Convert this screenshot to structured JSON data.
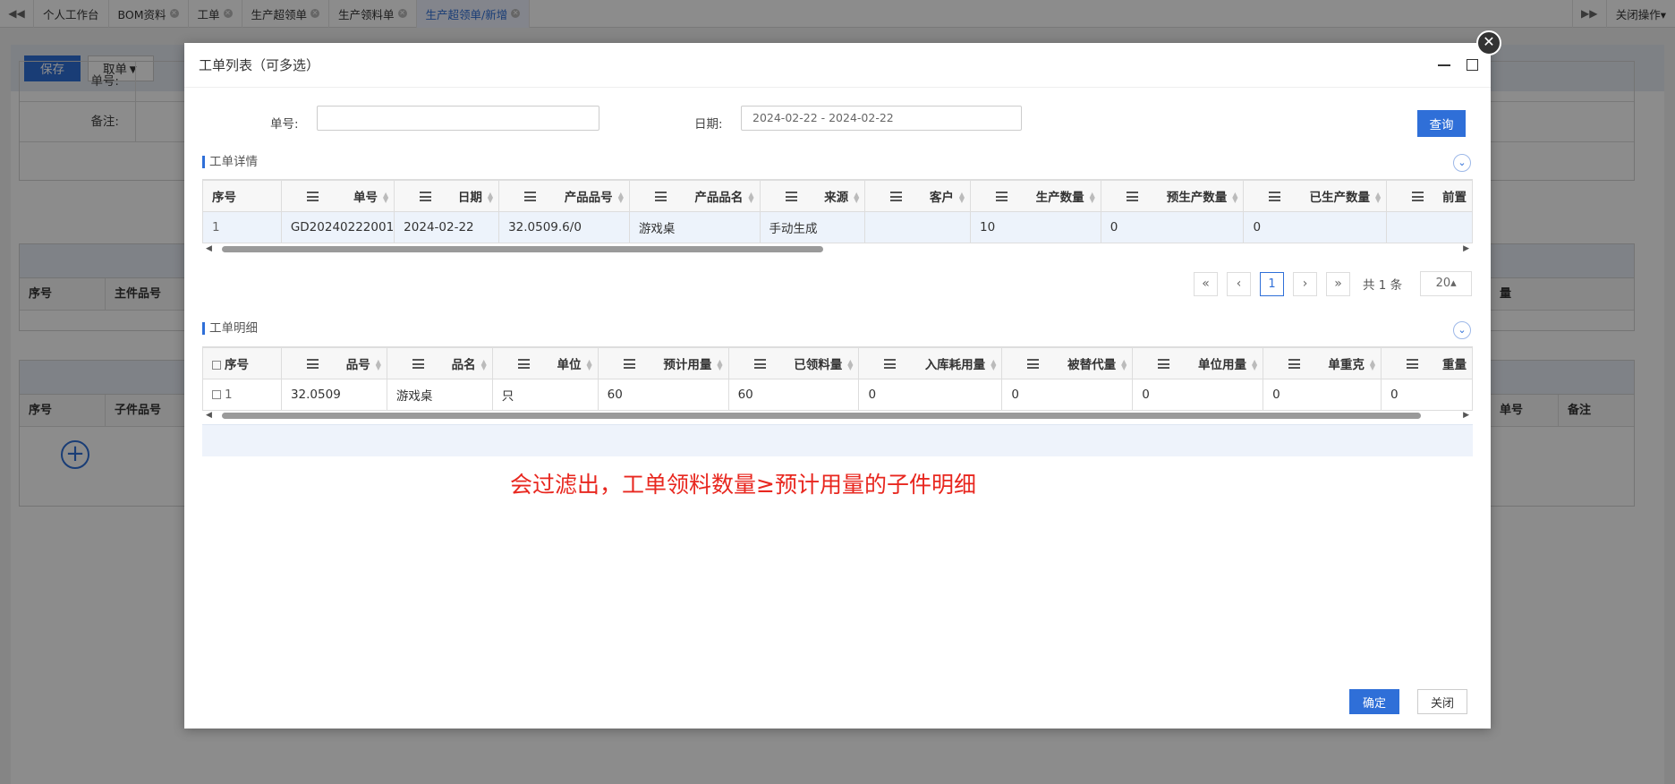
{
  "tabs": {
    "items": [
      {
        "label": "个人工作台",
        "closable": false,
        "active": false
      },
      {
        "label": "BOM资料",
        "closable": true,
        "active": false
      },
      {
        "label": "工单",
        "closable": true,
        "active": false
      },
      {
        "label": "生产超领单",
        "closable": true,
        "active": false
      },
      {
        "label": "生产领料单",
        "closable": true,
        "active": false
      },
      {
        "label": "生产超领单/新增",
        "closable": true,
        "active": true
      }
    ],
    "close_ops": "关闭操作▾"
  },
  "background": {
    "save_label": "保存",
    "fetch_label": "取单▼",
    "form": {
      "order_no_label": "单号:",
      "remark_label": "备注:"
    },
    "table1": {
      "cols": [
        "序号",
        "主件品号"
      ],
      "right_col": "量"
    },
    "table2": {
      "cols": [
        "序号",
        "子件品号"
      ],
      "right_cols": [
        "单号",
        "备注"
      ]
    }
  },
  "modal": {
    "title": "工单列表（可多选）",
    "search": {
      "order_no_label": "单号:",
      "order_no_value": "",
      "date_label": "日期:",
      "date_value": "2024-02-22 - 2024-02-22",
      "query_label": "查询"
    },
    "detail_section": {
      "title": "工单详情",
      "columns": [
        "序号",
        "单号",
        "日期",
        "产品品号",
        "产品品名",
        "来源",
        "客户",
        "生产数量",
        "预生产数量",
        "已生产数量",
        "前置"
      ],
      "rows": [
        [
          "1",
          "GD20240222001",
          "2024-02-22",
          "32.0509.6/0",
          "游戏桌",
          "手动生成",
          "",
          "10",
          "0",
          "0",
          ""
        ]
      ]
    },
    "pagination": {
      "first": "«",
      "prev": "‹",
      "current": "1",
      "next": "›",
      "last": "»",
      "total": "共 1 条",
      "page_size": "20▴"
    },
    "items_section": {
      "title": "工单明细",
      "columns": [
        "序号",
        "品号",
        "品名",
        "单位",
        "预计用量",
        "已领料量",
        "入库耗用量",
        "被替代量",
        "单位用量",
        "单重克",
        "重量"
      ],
      "rows": [
        [
          "1",
          "32.0509",
          "游戏桌",
          "只",
          "60",
          "60",
          "0",
          "0",
          "0",
          "0",
          "0"
        ]
      ]
    },
    "annotation": "会过滤出，工单领料数量≥预计用量的子件明细",
    "ok_label": "确定",
    "close_label": "关闭"
  },
  "colors": {
    "accent": "#2f6fd8",
    "annotation": "#e8271f"
  }
}
